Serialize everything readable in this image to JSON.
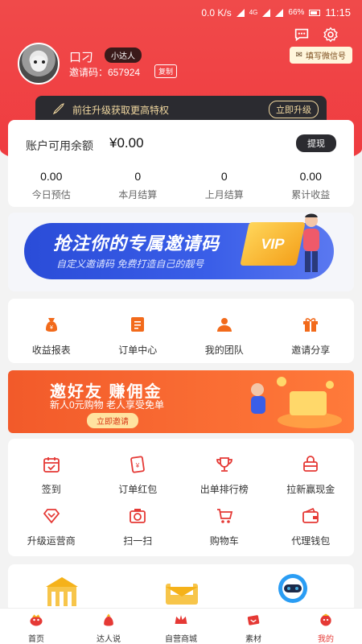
{
  "status_bar": {
    "net_speed": "0.0 K/s",
    "network": "4G",
    "battery": "66%",
    "time": "11:15"
  },
  "profile": {
    "username": "口刁",
    "level_badge": "小达人",
    "invite_code_text": "邀请码：657924",
    "copy_label": "复制",
    "wechat_label": "填写微信号"
  },
  "upgrade_bar": {
    "text": "前往升级获取更高特权",
    "button": "立即升级"
  },
  "balance": {
    "label": "账户可用余额",
    "value": "¥0.00",
    "withdraw": "提现",
    "stats": [
      {
        "value": "0.00",
        "label": "今日预估"
      },
      {
        "value": "0",
        "label": "本月结算"
      },
      {
        "value": "0",
        "label": "上月结算"
      },
      {
        "value": "0.00",
        "label": "累计收益"
      }
    ]
  },
  "banner_invite_code": {
    "title": "抢注你的专属邀请码",
    "subtitle": "自定义邀请码 免费打造自己的靓号",
    "vip": "VIP"
  },
  "main_menu": [
    {
      "label": "收益报表",
      "icon": "money-bag-icon"
    },
    {
      "label": "订单中心",
      "icon": "order-list-icon"
    },
    {
      "label": "我的团队",
      "icon": "team-icon"
    },
    {
      "label": "邀请分享",
      "icon": "gift-icon"
    }
  ],
  "banner_invite_friends": {
    "title": "邀好友 赚佣金",
    "subtitle": "新人0元购物 老人享受免单",
    "button": "立即邀请"
  },
  "tools": [
    {
      "label": "签到",
      "icon": "calendar-check-icon"
    },
    {
      "label": "订单红包",
      "icon": "red-envelope-icon"
    },
    {
      "label": "出单排行榜",
      "icon": "trophy-icon"
    },
    {
      "label": "拉新赢现金",
      "icon": "shopping-bag-icon"
    },
    {
      "label": "升级运营商",
      "icon": "diamond-icon"
    },
    {
      "label": "扫一扫",
      "icon": "camera-scan-icon"
    },
    {
      "label": "购物车",
      "icon": "cart-icon"
    },
    {
      "label": "代理钱包",
      "icon": "wallet-icon"
    }
  ],
  "tabbar": [
    {
      "label": "首页",
      "icon": "home-icon"
    },
    {
      "label": "达人说",
      "icon": "talk-icon"
    },
    {
      "label": "自营商城",
      "icon": "crown-icon"
    },
    {
      "label": "素材",
      "icon": "material-icon"
    },
    {
      "label": "我的",
      "icon": "mine-icon",
      "active": true
    }
  ],
  "colors": {
    "brand_red": "#ef3a3f",
    "accent_orange": "#f25a2a",
    "dark_pill": "#2b2b30",
    "gold": "#f1d8a0"
  }
}
